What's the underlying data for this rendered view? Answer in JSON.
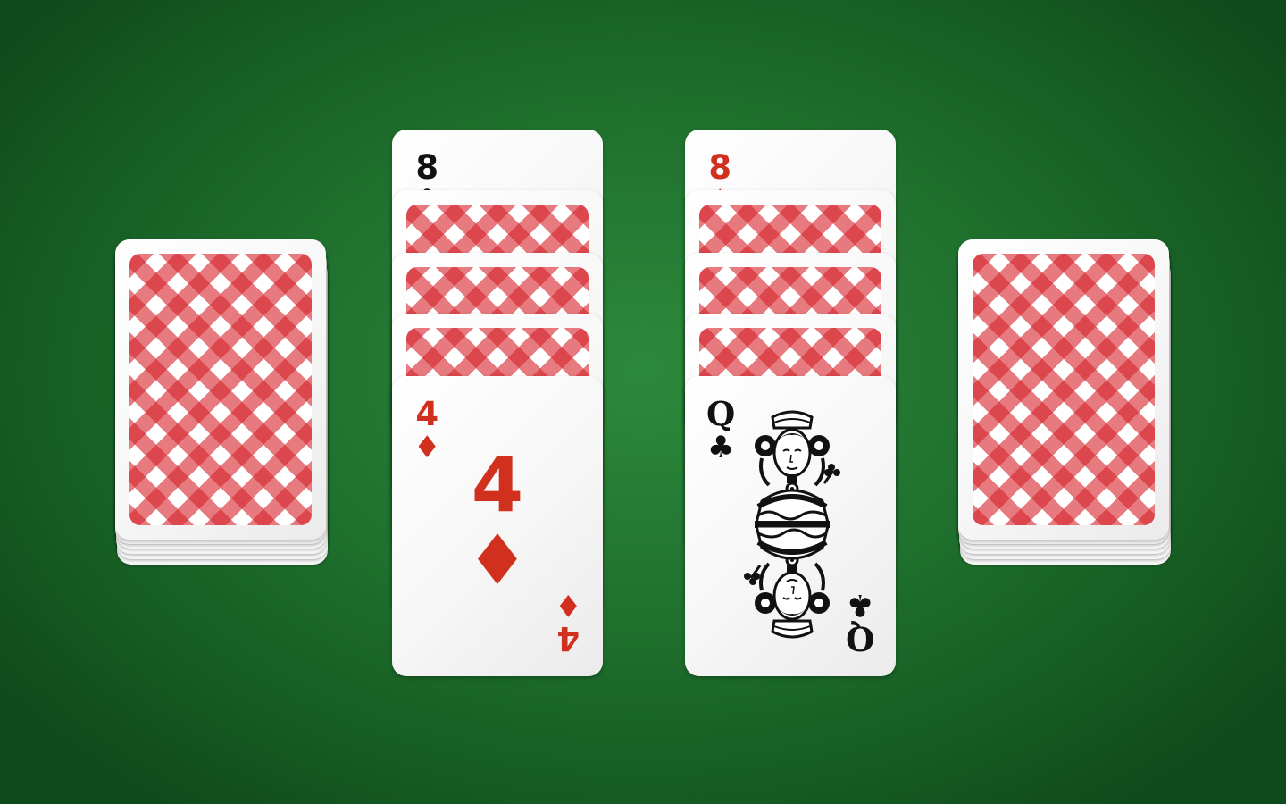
{
  "colors": {
    "felt": "#1f6f2d",
    "card_back_red": "#d6282f",
    "red_suit": "#d1301f",
    "black_suit": "#111111"
  },
  "table": {
    "left_deck": {
      "face": "down"
    },
    "right_deck": {
      "face": "down"
    },
    "pile_left": {
      "top_card": {
        "rank": "8",
        "suit": "♣",
        "suit_name": "clubs",
        "color": "black"
      },
      "face_down_count": 3,
      "face_card": {
        "rank": "4",
        "suit": "♦",
        "suit_name": "diamonds",
        "color": "red"
      }
    },
    "pile_right": {
      "top_card": {
        "rank": "8",
        "suit": "♦",
        "suit_name": "diamonds",
        "color": "red"
      },
      "face_down_count": 3,
      "face_card": {
        "rank": "Q",
        "suit": "♣",
        "suit_name": "clubs",
        "color": "black",
        "icon": "queen-figure-icon"
      }
    }
  }
}
